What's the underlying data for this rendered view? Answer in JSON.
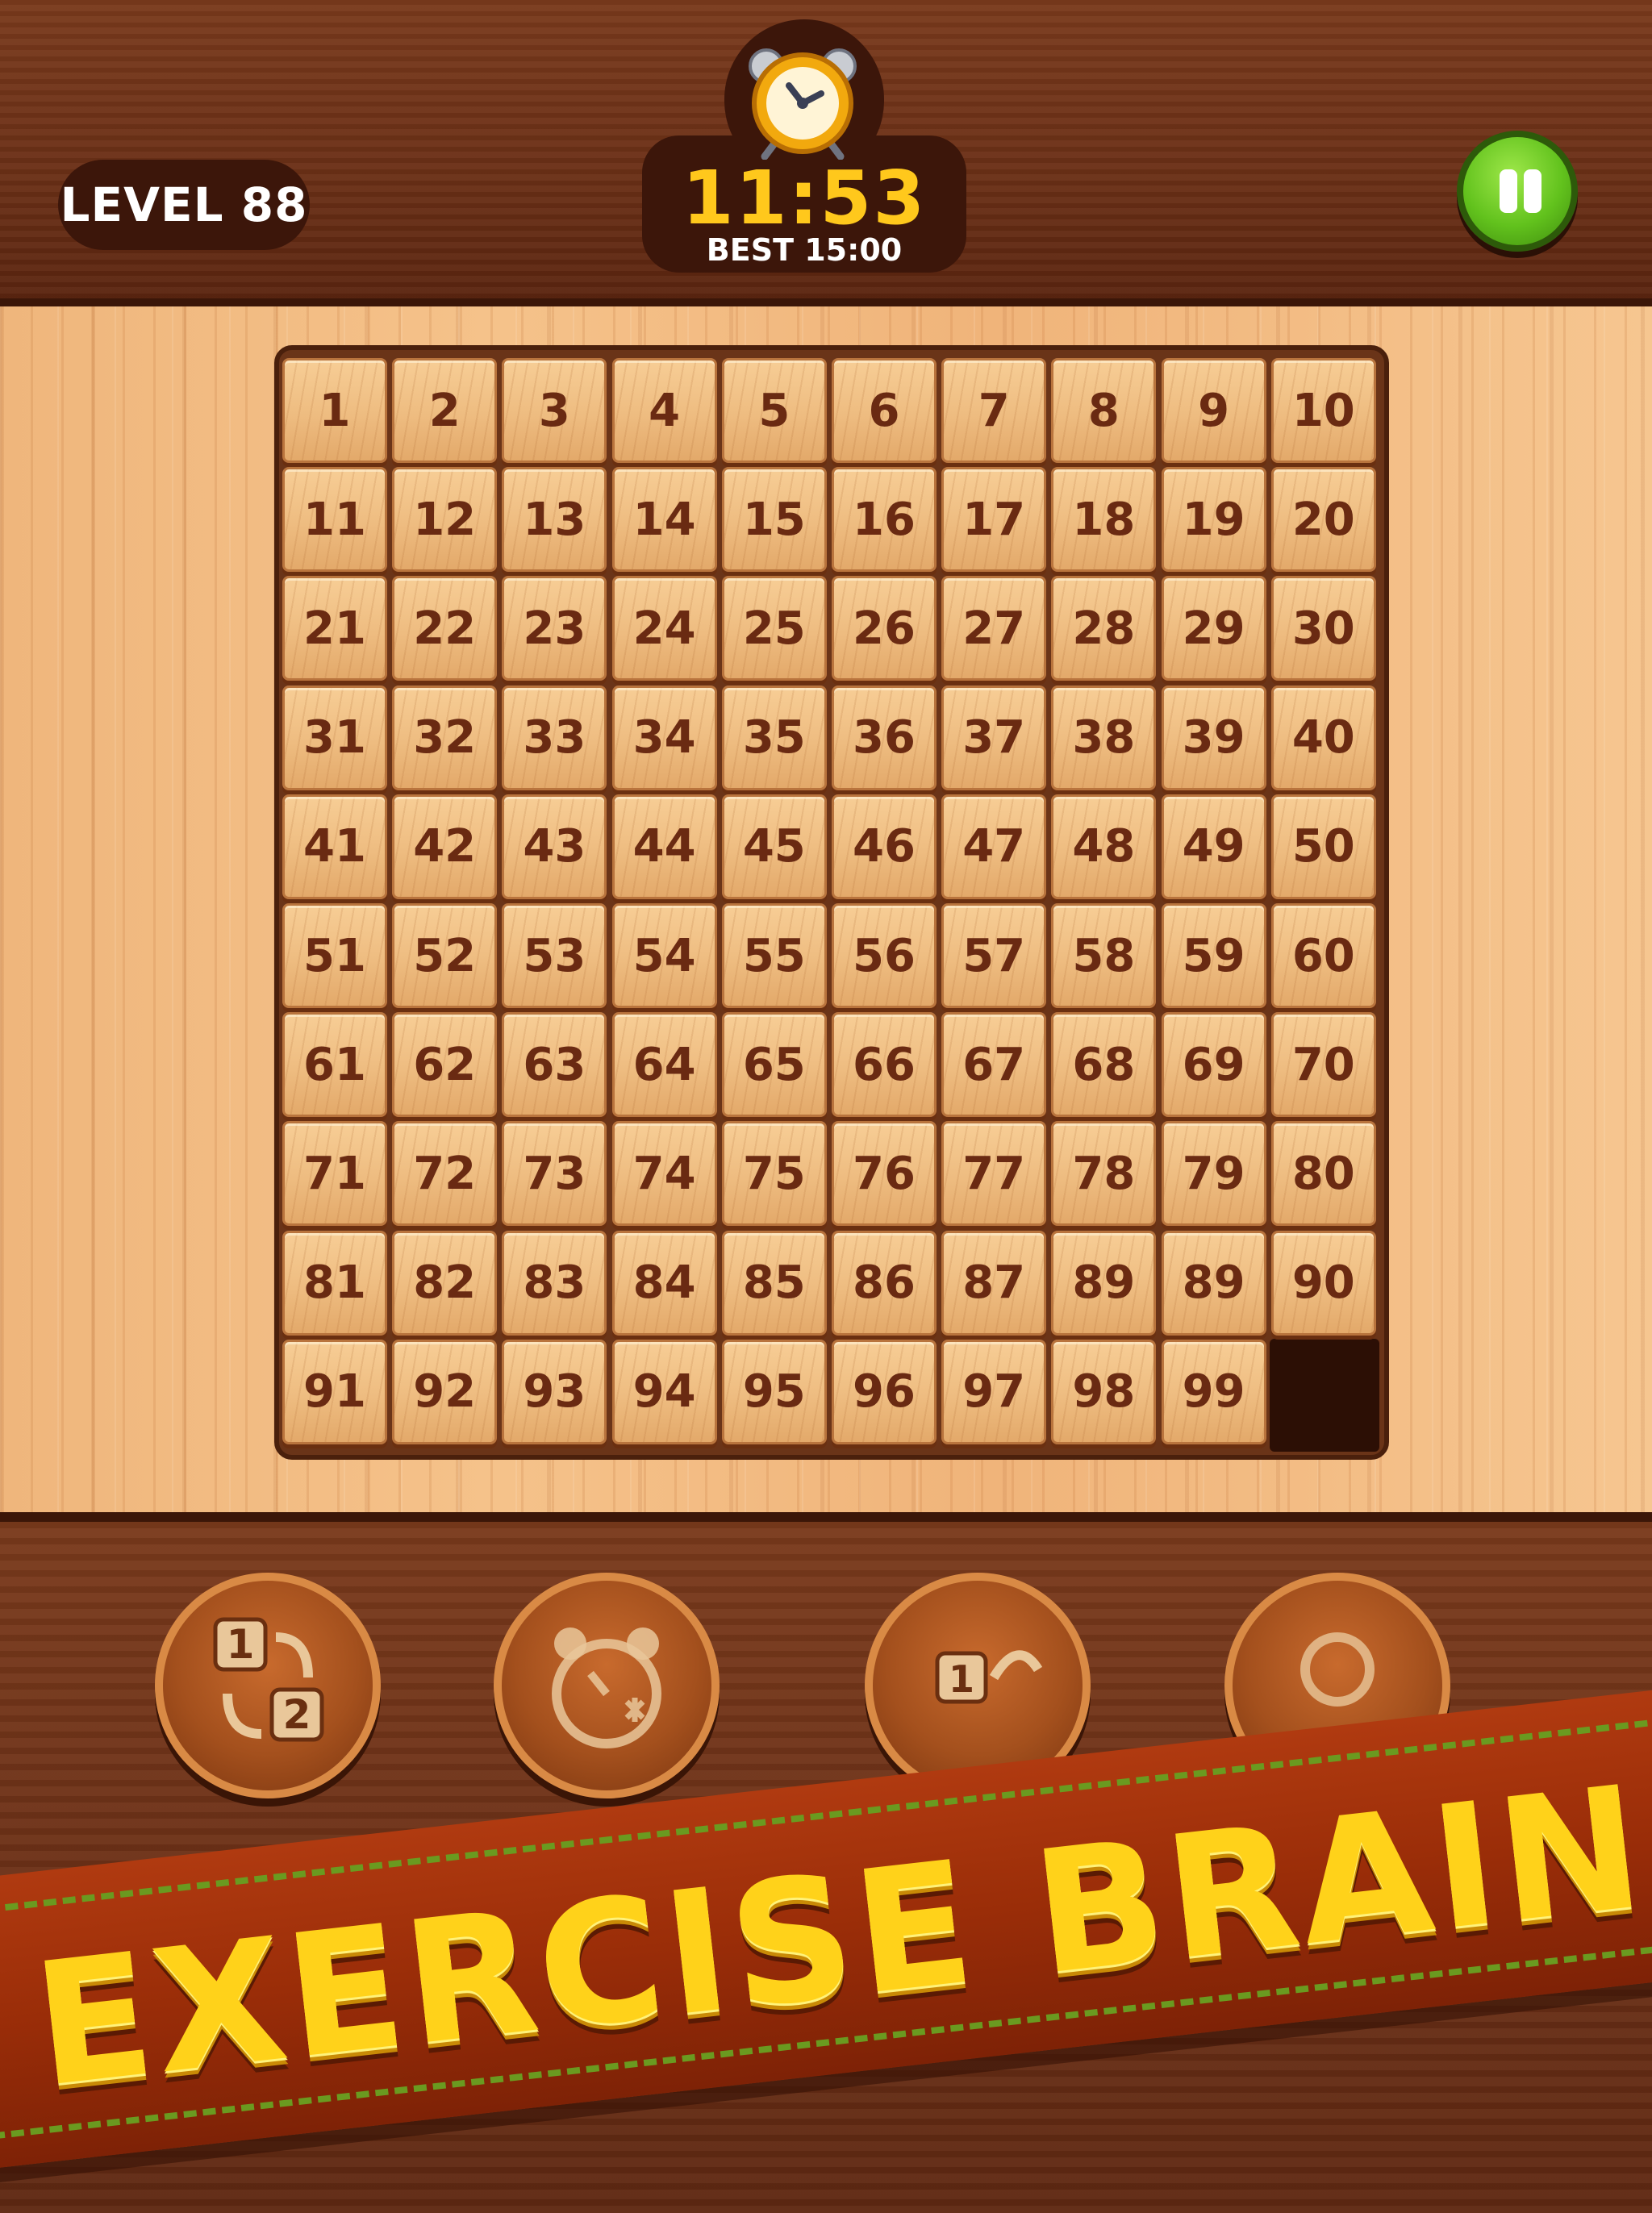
{
  "header": {
    "level_label": "LEVEL 88",
    "timer": "11:53",
    "best": "BEST 15:00",
    "timer_color": "#ffc81c",
    "pause_icon": "pause-icon",
    "pause_color": "#62c21d"
  },
  "board": {
    "columns": 10,
    "rows": 10,
    "tiles": [
      "1",
      "2",
      "3",
      "4",
      "5",
      "6",
      "7",
      "8",
      "9",
      "10",
      "11",
      "12",
      "13",
      "14",
      "15",
      "16",
      "17",
      "18",
      "19",
      "20",
      "21",
      "22",
      "23",
      "24",
      "25",
      "26",
      "27",
      "28",
      "29",
      "30",
      "31",
      "32",
      "33",
      "34",
      "35",
      "36",
      "37",
      "38",
      "39",
      "40",
      "41",
      "42",
      "43",
      "44",
      "45",
      "46",
      "47",
      "48",
      "49",
      "50",
      "51",
      "52",
      "53",
      "54",
      "55",
      "56",
      "57",
      "58",
      "59",
      "60",
      "61",
      "62",
      "63",
      "64",
      "65",
      "66",
      "67",
      "68",
      "69",
      "70",
      "71",
      "72",
      "73",
      "74",
      "75",
      "76",
      "77",
      "78",
      "79",
      "80",
      "81",
      "82",
      "83",
      "84",
      "85",
      "86",
      "87",
      "89",
      "89",
      "90",
      "91",
      "92",
      "93",
      "94",
      "95",
      "96",
      "97",
      "98",
      "99",
      ""
    ]
  },
  "tools": [
    {
      "name": "swap-tiles",
      "icon": "swap-numbers-icon"
    },
    {
      "name": "freeze-time",
      "icon": "freeze-clock-icon"
    },
    {
      "name": "undo",
      "icon": "undo-tile-icon"
    },
    {
      "name": "hint",
      "icon": "hint-icon"
    }
  ],
  "banner": {
    "text": "EXERCISE BRAIN",
    "text_color": "#ffd21a",
    "ribbon_color": "#9a2d08",
    "stitch_color": "#6a9a20"
  }
}
